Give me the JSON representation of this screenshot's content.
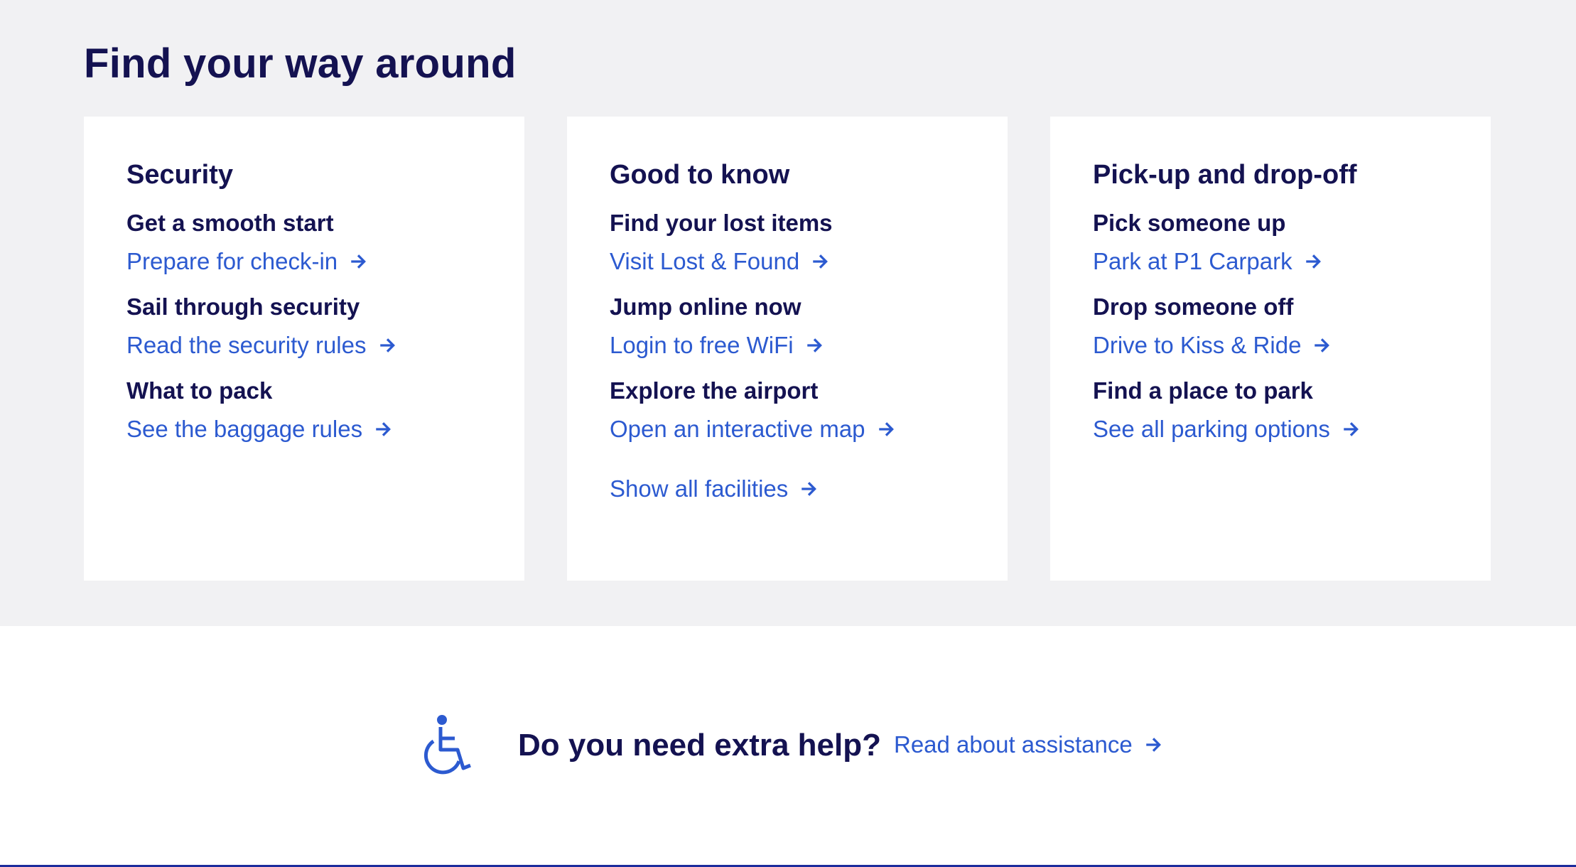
{
  "section": {
    "title": "Find your way around"
  },
  "cards": [
    {
      "title": "Security",
      "items": [
        {
          "heading": "Get a smooth start",
          "link": "Prepare for check-in"
        },
        {
          "heading": "Sail through security",
          "link": "Read the security rules"
        },
        {
          "heading": "What to pack",
          "link": "See the baggage rules"
        }
      ]
    },
    {
      "title": "Good to know",
      "items": [
        {
          "heading": "Find your lost items",
          "link": "Visit Lost & Found"
        },
        {
          "heading": "Jump online now",
          "link": "Login to free WiFi"
        },
        {
          "heading": "Explore the airport",
          "link": "Open an interactive map"
        }
      ],
      "extra_link": "Show all facilities"
    },
    {
      "title": "Pick-up and drop-off",
      "items": [
        {
          "heading": "Pick someone up",
          "link": "Park at P1 Carpark"
        },
        {
          "heading": "Drop someone off",
          "link": "Drive to Kiss & Ride"
        },
        {
          "heading": "Find a place to park",
          "link": "See all parking options"
        }
      ]
    }
  ],
  "help": {
    "icon": "wheelchair-icon",
    "text": "Do you need extra help?",
    "link": "Read about assistance"
  },
  "colors": {
    "heading": "#141251",
    "link": "#2c5ad0",
    "section_bg": "#f1f1f3",
    "card_bg": "#ffffff"
  }
}
